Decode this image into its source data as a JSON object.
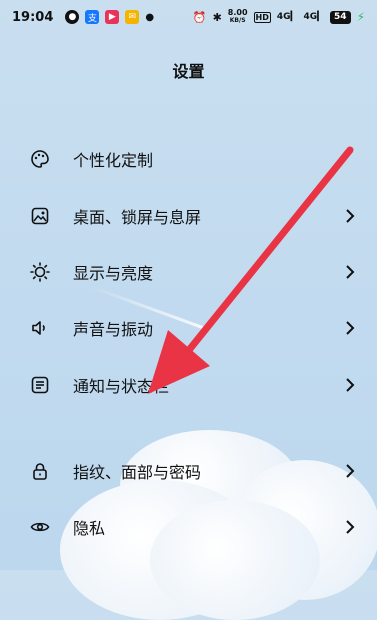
{
  "status_bar": {
    "time": "19:04",
    "net_speed_value": "8.00",
    "net_speed_unit": "KB/S",
    "hd_label": "HD",
    "signal_1": "4G",
    "signal_2": "4G",
    "battery": "54",
    "app_icons": [
      "wechat-icon",
      "alipay-icon",
      "video-icon",
      "mail-icon"
    ]
  },
  "header": {
    "title": "设置"
  },
  "settings": {
    "items": [
      {
        "label": "个性化定制",
        "icon": "palette-icon"
      },
      {
        "label": "桌面、锁屏与息屏",
        "icon": "image-frame-icon"
      },
      {
        "label": "显示与亮度",
        "icon": "sun-icon"
      },
      {
        "label": "声音与振动",
        "icon": "speaker-icon"
      },
      {
        "label": "通知与状态栏",
        "icon": "notification-icon"
      },
      {
        "label": "指纹、面部与密码",
        "icon": "lock-icon"
      },
      {
        "label": "隐私",
        "icon": "eye-icon"
      }
    ]
  },
  "annotation": {
    "arrow_color": "#e83445"
  },
  "colors": {
    "background": "#c3dbef",
    "text": "#111111"
  }
}
